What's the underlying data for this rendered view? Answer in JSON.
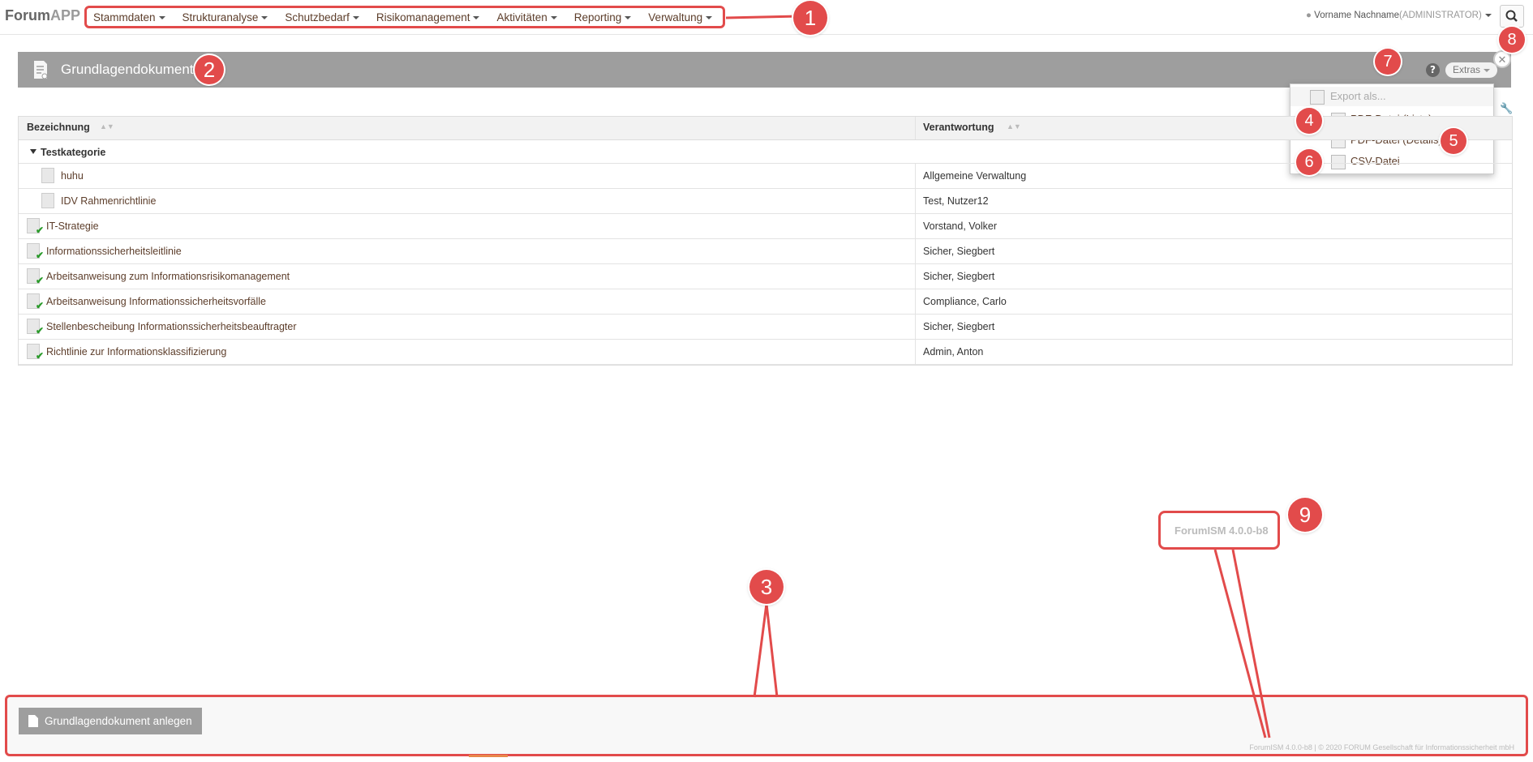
{
  "app": {
    "logo_main": "Forum",
    "logo_accent": "APP"
  },
  "nav": {
    "items": [
      "Stammdaten",
      "Strukturanalyse",
      "Schutzbedarf",
      "Risikomanagement",
      "Aktivitäten",
      "Reporting",
      "Verwaltung"
    ]
  },
  "user": {
    "name": "Vorname Nachname",
    "role": "(ADMINISTRATOR)"
  },
  "header": {
    "title": "Grundlagendokumente",
    "help": "?",
    "extras_label": "Extras"
  },
  "dropdown": {
    "items": [
      "Export als...",
      "PDF-Datei (Liste)",
      "PDF-Datei (Details)",
      "CSV-Datei"
    ]
  },
  "table": {
    "columns": [
      "Bezeichnung",
      "Verantwortung"
    ],
    "category": "Testkategorie",
    "rows": [
      {
        "name": "huhu",
        "responsible": "Allgemeine Verwaltung",
        "indent": true,
        "status": false
      },
      {
        "name": "IDV Rahmenrichtlinie",
        "responsible": "Test, Nutzer12",
        "indent": true,
        "status": false
      },
      {
        "name": "IT-Strategie",
        "responsible": "Vorstand, Volker",
        "indent": false,
        "status": true
      },
      {
        "name": "Informationssicherheitsleitlinie",
        "responsible": "Sicher, Siegbert",
        "indent": false,
        "status": true
      },
      {
        "name": "Arbeitsanweisung zum Informationsrisikomanagement",
        "responsible": "Sicher, Siegbert",
        "indent": false,
        "status": true
      },
      {
        "name": "Arbeitsanweisung Informationssicherheitsvorfälle",
        "responsible": "Compliance, Carlo",
        "indent": false,
        "status": true
      },
      {
        "name": "Stellenbescheibung Informationssicherheitsbeauftragter",
        "responsible": "Sicher, Siegbert",
        "indent": false,
        "status": true
      },
      {
        "name": "Richtlinie zur Informationsklassifizierung",
        "responsible": "Admin, Anton",
        "indent": false,
        "status": true
      }
    ]
  },
  "version": {
    "label": "ForumISM 4.0.0-b8"
  },
  "footer": {
    "create_button": "Grundlagendokument anlegen",
    "note": "ForumISM 4.0.0-b8 | © 2020 FORUM Gesellschaft für Informationssicherheit mbH"
  },
  "badges": [
    "1",
    "2",
    "3",
    "4",
    "5",
    "6",
    "7",
    "8",
    "9"
  ],
  "colors": {
    "annotation": "#e24b4b",
    "header_bg": "#9e9e9e",
    "link": "#5c3d2a"
  }
}
